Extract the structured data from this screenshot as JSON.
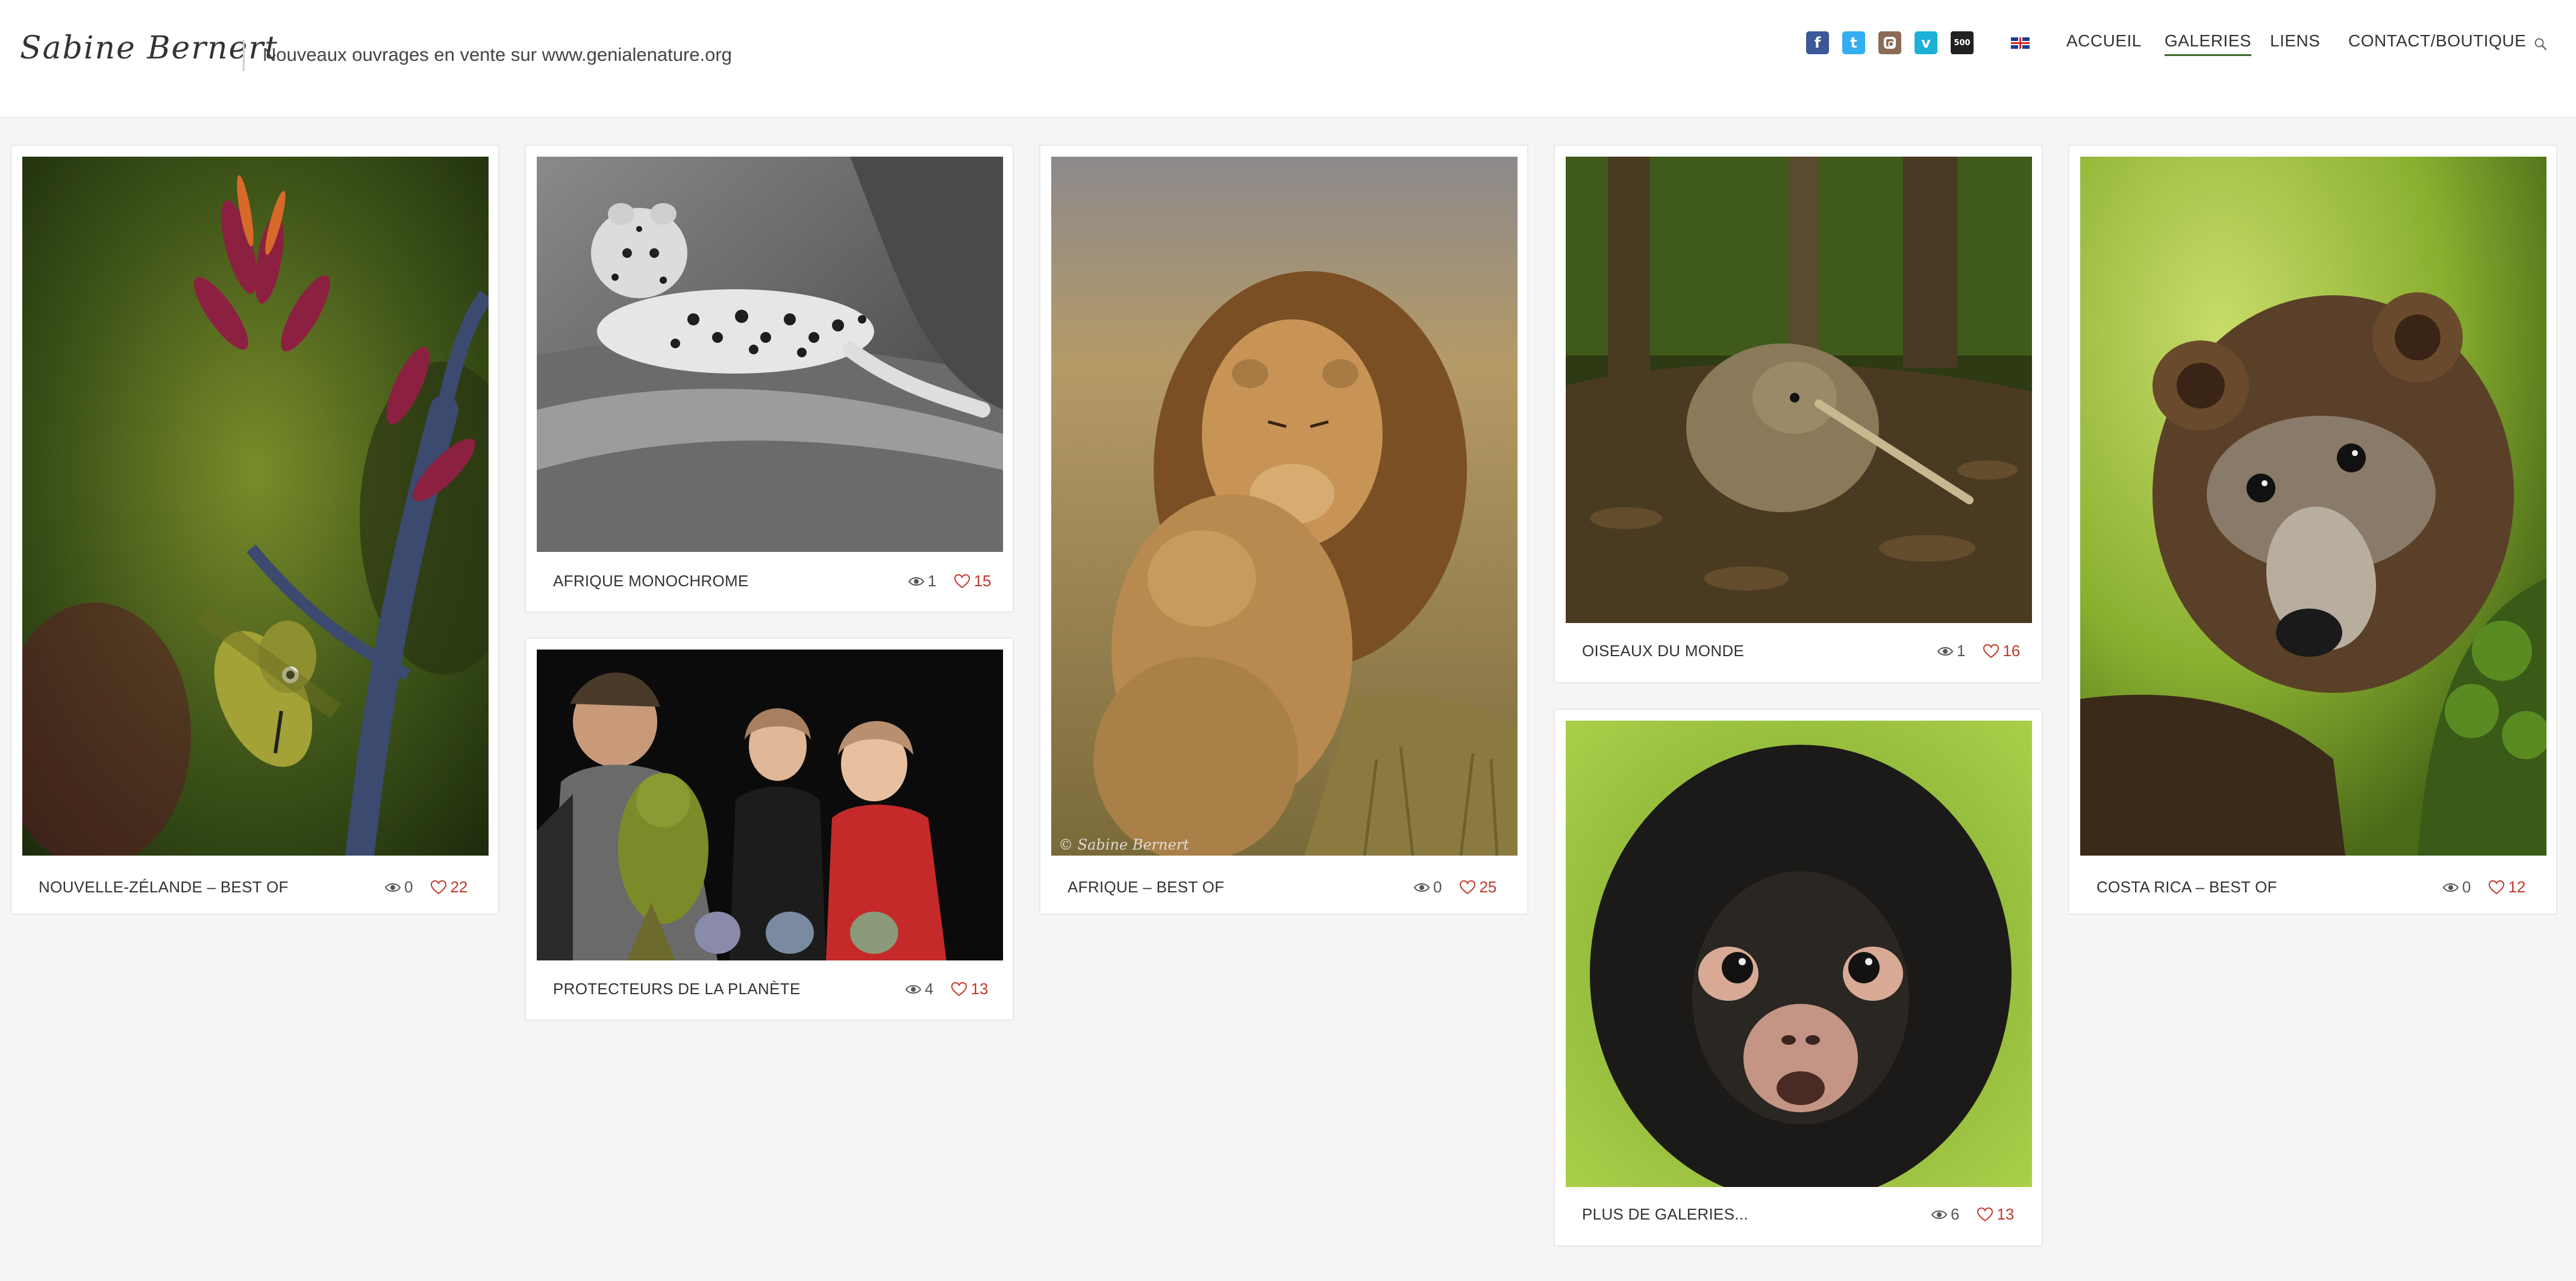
{
  "header": {
    "logo": "Sabine Bernert",
    "tagline": "Nouveaux ouvrages en vente sur www.genialenature.org",
    "social": [
      {
        "name": "facebook",
        "glyph": "f"
      },
      {
        "name": "twitter",
        "glyph": "t"
      },
      {
        "name": "instagram",
        "glyph": ""
      },
      {
        "name": "vimeo",
        "glyph": "v"
      },
      {
        "name": "500px",
        "glyph": "500"
      }
    ],
    "language": "uk-flag",
    "nav": {
      "accueil": "ACCUEIL",
      "galeries": "GALERIES",
      "liens": "LIENS",
      "contact": "CONTACT/BOUTIQUE"
    },
    "active_nav": "GALERIES",
    "accent_color": "#3d6a2a"
  },
  "galleries": [
    {
      "title": "NOUVELLE-ZÉLANDE – BEST OF",
      "views": "0",
      "likes": "22",
      "image": "tui bird on flax flowers"
    },
    {
      "title": "AFRIQUE MONOCHROME",
      "views": "1",
      "likes": "15",
      "image": "leopard on tree, black and white"
    },
    {
      "title": "PROTECTEURS DE LA PLANÈTE",
      "views": "4",
      "likes": "13",
      "image": "woman holding kakapo with children"
    },
    {
      "title": "AFRIQUE – BEST OF",
      "views": "0",
      "likes": "25",
      "image": "lion hugging cub"
    },
    {
      "title": "OISEAUX DU MONDE",
      "views": "1",
      "likes": "16",
      "image": "kiwi bird in forest"
    },
    {
      "title": "PLUS DE GALERIES...",
      "views": "6",
      "likes": "13",
      "image": "spider monkey portrait"
    },
    {
      "title": "COSTA RICA – BEST OF",
      "views": "0",
      "likes": "12",
      "image": "coati peeking from tree"
    }
  ],
  "watermark": "© Sabine Bernert",
  "colors": {
    "like": "#c0392b",
    "background": "#f5f5f5"
  }
}
